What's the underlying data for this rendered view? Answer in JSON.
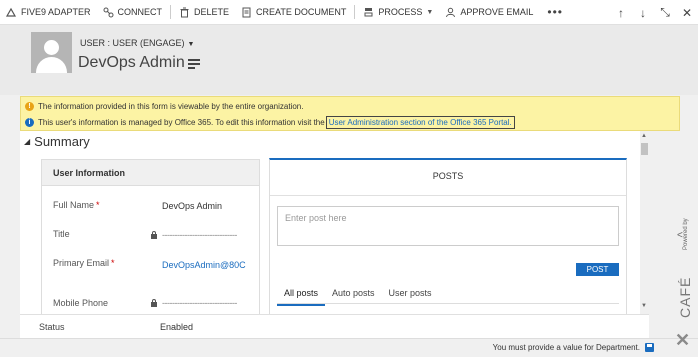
{
  "commandbar": {
    "items": [
      {
        "label": "FIVE9 ADAPTER",
        "icon": "five9-icon"
      },
      {
        "label": "CONNECT",
        "icon": "connect-icon"
      },
      {
        "label": "DELETE",
        "icon": "trash-icon"
      },
      {
        "label": "CREATE DOCUMENT",
        "icon": "document-icon"
      },
      {
        "label": "PROCESS",
        "icon": "process-icon"
      },
      {
        "label": "APPROVE EMAIL",
        "icon": "person-icon"
      }
    ],
    "more": "•••"
  },
  "nav": {
    "up": "↑",
    "down": "↓",
    "expand": "⤡",
    "close": "✕"
  },
  "header": {
    "form_selector": "USER : USER (ENGAGE)",
    "record_name": "DevOps Admin"
  },
  "notifications": {
    "warning_text": "The information provided in this form is viewable by the entire organization.",
    "info_text": "This user's information is managed by Office 365. To edit this information visit the",
    "info_link": "User Administration section of the Office 365 Portal."
  },
  "summary": {
    "title": "Summary",
    "panel_title": "User Information",
    "fields": [
      {
        "label": "Full Name",
        "required": "*",
        "value": "DevOps Admin"
      },
      {
        "label": "Title",
        "value": "------------------------------"
      },
      {
        "label": "Primary Email",
        "required": "*",
        "value": "DevOpsAdmin@80C"
      },
      {
        "label": "Mobile Phone",
        "value": "------------------------------"
      }
    ]
  },
  "posts": {
    "title": "POSTS",
    "placeholder": "Enter post here",
    "post_button": "POST",
    "tabs": [
      "All posts",
      "Auto posts",
      "User posts"
    ],
    "active_tab": "All posts"
  },
  "status": {
    "label": "Status",
    "value": "Enabled"
  },
  "footer": {
    "message": "You must provide a value for Department."
  },
  "branding": {
    "powered": "Powered by",
    "name": "CAFÉ"
  },
  "colors": {
    "accent": "#1a6cbf",
    "notification_bg": "#fcf3a4",
    "warning": "#e8a317"
  }
}
